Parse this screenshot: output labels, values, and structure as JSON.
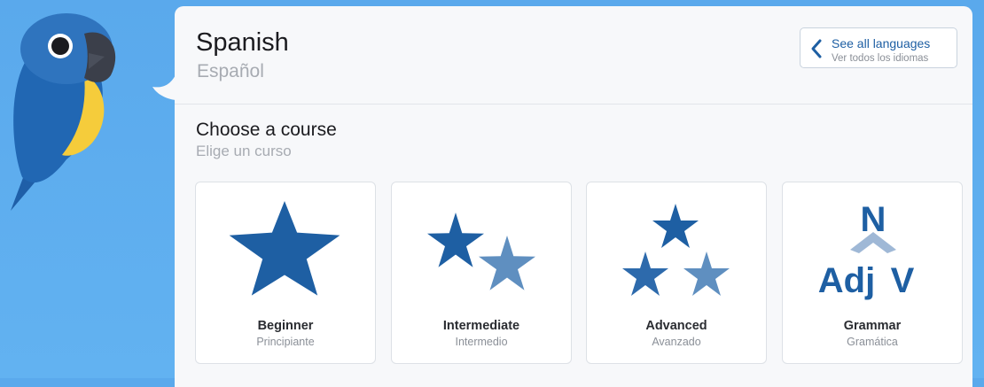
{
  "language": {
    "title": "Spanish",
    "native": "Español"
  },
  "see_all": {
    "label": "See all languages",
    "sublabel": "Ver todos los idiomas"
  },
  "course_section": {
    "title": "Choose a course",
    "subtitle": "Elige un curso"
  },
  "courses": [
    {
      "name": "Beginner",
      "sub": "Principiante",
      "icon": "single-star-icon"
    },
    {
      "name": "Intermediate",
      "sub": "Intermedio",
      "icon": "two-stars-icon"
    },
    {
      "name": "Advanced",
      "sub": "Avanzado",
      "icon": "three-stars-icon"
    },
    {
      "name": "Grammar",
      "sub": "Gramática",
      "icon": "grammar-tree-icon",
      "glyphs": {
        "top": "N",
        "left": "Adj",
        "right": "V"
      }
    }
  ],
  "colors": {
    "accent": "#1e5fa3",
    "star_dark": "#1e5fa3",
    "star_light": "#5f8fc0",
    "background": "#5aa9ec"
  }
}
